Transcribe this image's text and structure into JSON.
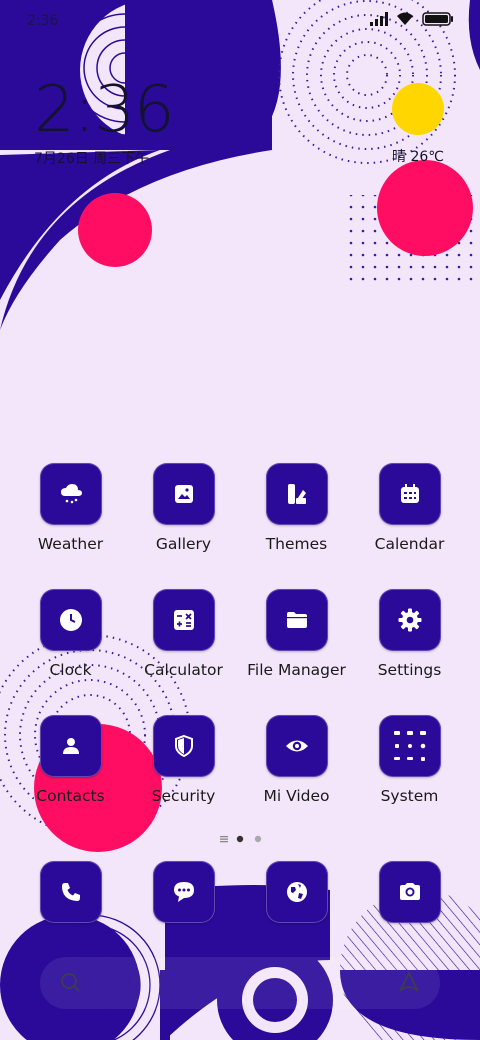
{
  "status_bar": {
    "time": "2:36"
  },
  "clock": {
    "time": "2:36",
    "date": "7月26日 周三下午"
  },
  "weather": {
    "text": "晴 26℃"
  },
  "apps": [
    {
      "label": "Weather",
      "icon": "cloud-rain-icon"
    },
    {
      "label": "Gallery",
      "icon": "image-icon"
    },
    {
      "label": "Themes",
      "icon": "palette-icon"
    },
    {
      "label": "Calendar",
      "icon": "calendar-icon"
    },
    {
      "label": "Clock",
      "icon": "clock-icon"
    },
    {
      "label": "Calculator",
      "icon": "calculator-icon"
    },
    {
      "label": "File Manager",
      "icon": "folder-icon"
    },
    {
      "label": "Settings",
      "icon": "gear-icon"
    },
    {
      "label": "Contacts",
      "icon": "person-icon"
    },
    {
      "label": "Security",
      "icon": "shield-icon"
    },
    {
      "label": "Mi Video",
      "icon": "eye-icon"
    },
    {
      "label": "System",
      "icon": "folder-grid-icon"
    }
  ],
  "page_indicator": {
    "pages": 3,
    "active": 1
  },
  "dock": [
    {
      "name": "phone",
      "icon": "phone-icon"
    },
    {
      "name": "messages",
      "icon": "chat-icon"
    },
    {
      "name": "browser",
      "icon": "globe-icon"
    },
    {
      "name": "camera",
      "icon": "camera-icon"
    }
  ],
  "colors": {
    "accent": "#2b0a9a",
    "pink": "#ff0d62",
    "yellow": "#ffd600",
    "bg": "#f4e6fa"
  }
}
